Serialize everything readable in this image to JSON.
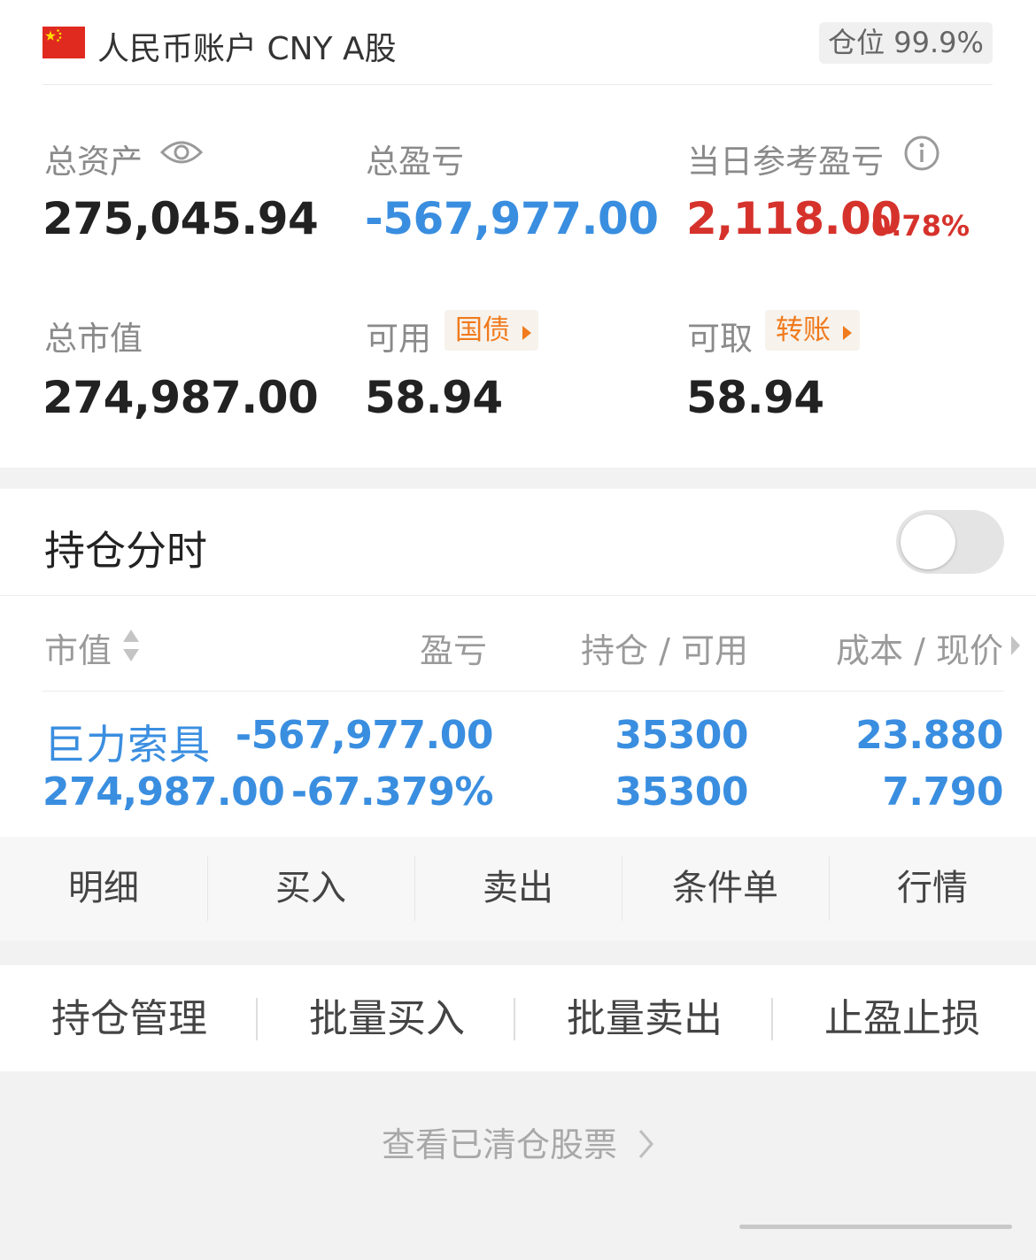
{
  "account": {
    "flag_icon": "china-flag-icon",
    "title": "人民币账户 CNY A股",
    "position_label": "仓位",
    "position_value": "99.9%",
    "total_assets_label": "总资产",
    "total_assets_value": "275,045.94",
    "total_pnl_label": "总盈亏",
    "total_pnl_value": "-567,977.00",
    "daily_pnl_label": "当日参考盈亏",
    "daily_pnl_value": "2,118.00",
    "daily_pnl_pct": "0.78%",
    "market_value_label": "总市值",
    "market_value_value": "274,987.00",
    "available_label": "可用",
    "available_tag": "国债",
    "available_value": "58.94",
    "withdrawable_label": "可取",
    "withdrawable_tag": "转账",
    "withdrawable_value": "58.94"
  },
  "holdings": {
    "title": "持仓分时",
    "toggle_on": false,
    "columns": {
      "market_value": "市值",
      "pnl": "盈亏",
      "position": "持仓 / 可用",
      "cost": "成本 / 现价"
    },
    "rows": [
      {
        "name": "巨力索具",
        "market_value": "274,987.00",
        "pnl": "-567,977.00",
        "pnl_pct": "-67.379%",
        "position": "35300",
        "available": "35300",
        "cost": "23.880",
        "price": "7.790"
      }
    ],
    "actions": [
      "明细",
      "买入",
      "卖出",
      "条件单",
      "行情"
    ]
  },
  "management": {
    "items": [
      "持仓管理",
      "批量买入",
      "批量卖出",
      "止盈止损"
    ]
  },
  "footer": {
    "cleared_link": "查看已清仓股票"
  },
  "colors": {
    "loss_blue": "#3a8ee0",
    "gain_red": "#d6322c",
    "tag_orange": "#f07a1c"
  }
}
